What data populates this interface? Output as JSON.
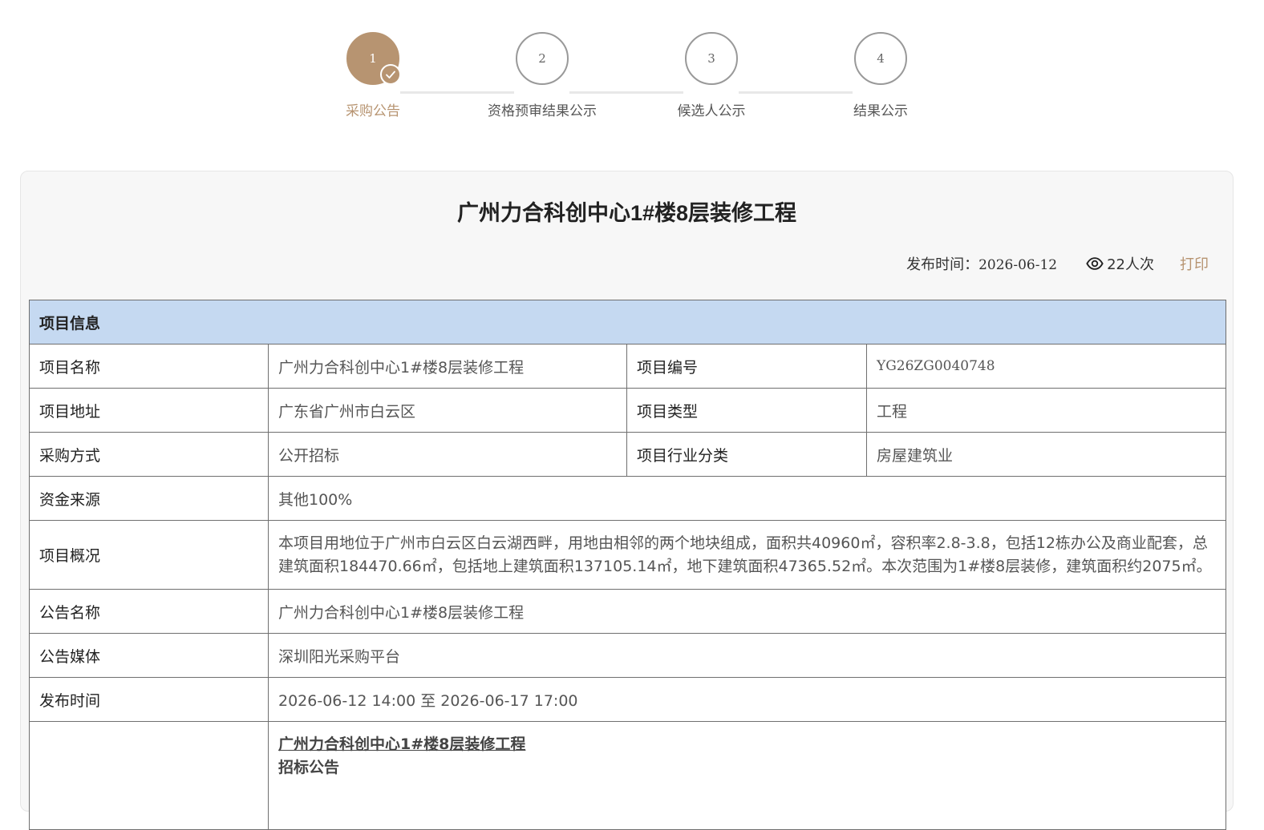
{
  "steps": [
    {
      "number": "1",
      "label": "采购公告",
      "active": true
    },
    {
      "number": "2",
      "label": "资格预审结果公示",
      "active": false
    },
    {
      "number": "3",
      "label": "候选人公示",
      "active": false
    },
    {
      "number": "4",
      "label": "结果公示",
      "active": false
    }
  ],
  "card": {
    "title": "广州力合科创中心1#楼8层装修工程",
    "publish_label": "发布时间：",
    "publish_date": "2026-06-12",
    "views": "22人次",
    "print_label": "打印"
  },
  "table": {
    "section_title": "项目信息",
    "project_name_label": "项目名称",
    "project_name": "广州力合科创中心1#楼8层装修工程",
    "project_code_label": "项目编号",
    "project_code": "YG26ZG0040748",
    "address_label": "项目地址",
    "address": "广东省广州市白云区",
    "type_label": "项目类型",
    "type": "工程",
    "method_label": "采购方式",
    "method": "公开招标",
    "industry_label": "项目行业分类",
    "industry": "房屋建筑业",
    "funds_label": "资金来源",
    "funds": "其他100%",
    "overview_label": "项目概况",
    "overview": "本项目用地位于广州市白云区白云湖西畔，用地由相邻的两个地块组成，面积共40960㎡，容积率2.8-3.8，包括12栋办公及商业配套，总建筑面积184470.66㎡，包括地上建筑面积137105.14㎡，地下建筑面积47365.52㎡。本次范围为1#楼8层装修，建筑面积约2075㎡。",
    "notice_name_label": "公告名称",
    "notice_name": "广州力合科创中心1#楼8层装修工程",
    "media_label": "公告媒体",
    "media": "深圳阳光采购平台",
    "time_label": "发布时间",
    "time_range": "2026-06-12 14:00 至 2026-06-17 17:00",
    "content_title": "广州力合科创中心1#楼8层装修工程",
    "content_subtitle": "招标公告"
  },
  "colors": {
    "accent": "#b79471",
    "table_header_bg": "#c5d9f1"
  }
}
